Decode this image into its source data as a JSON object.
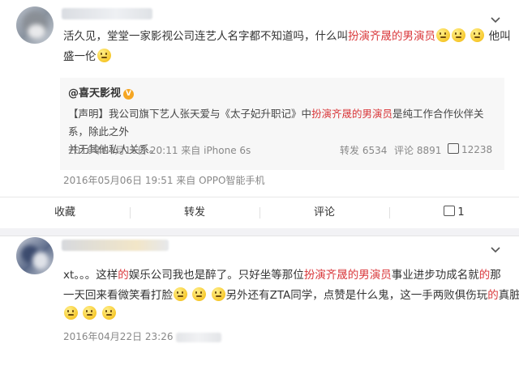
{
  "post1": {
    "text_part1": "活久见，堂堂一家影视公司连艺人名字都不知道吗，什么叫",
    "text_highlight": "扮演齐晟的男演员",
    "text_part2": "他叫",
    "text_line2": "盛一伦",
    "quote": {
      "author": "@喜天影视",
      "verified_icon": "V",
      "text_a": "【声明】我公司旗下艺人张天爱与《太子妃升职记》中",
      "text_highlight": "扮演齐晟的男演员",
      "text_b": "是纯工作合作伙伴关系，除此之外",
      "text_line2": "并无其他私人关系。",
      "meta": "2016年04月16日 20:11 来自 iPhone 6s",
      "repost": "转发 6534",
      "comment": "评论 8891",
      "likes": "12238"
    },
    "meta": "2016年05月06日 19:51 来自 OPPO智能手机",
    "actions": {
      "fav": "收藏",
      "repost": "转发",
      "comment": "评论",
      "like": "1"
    }
  },
  "post2": {
    "line1_a": "xt。。。这样",
    "line1_b": "的",
    "line1_c": "娱乐公司我也是醉了。只好坐等那位",
    "line1_highlight": "扮演齐晟的男演员",
    "line1_d": "事业进步功成名就",
    "line1_e": "的",
    "line1_f": "那",
    "line2_a": "一天回来看微笑看打脸",
    "line2_b": "另外还有ZTA同学，点赞是什么鬼，这一手两败俱伤玩",
    "line2_c": "的",
    "line2_d": "真脏",
    "meta": "2016年04月22日 23:26"
  },
  "icons": [
    "chevron-down-icon",
    "verified-icon",
    "like-icon",
    "emoji-smile-icon"
  ],
  "colors": {
    "highlight": "#d9373a",
    "verified": "#f5a623",
    "meta": "#888888"
  }
}
